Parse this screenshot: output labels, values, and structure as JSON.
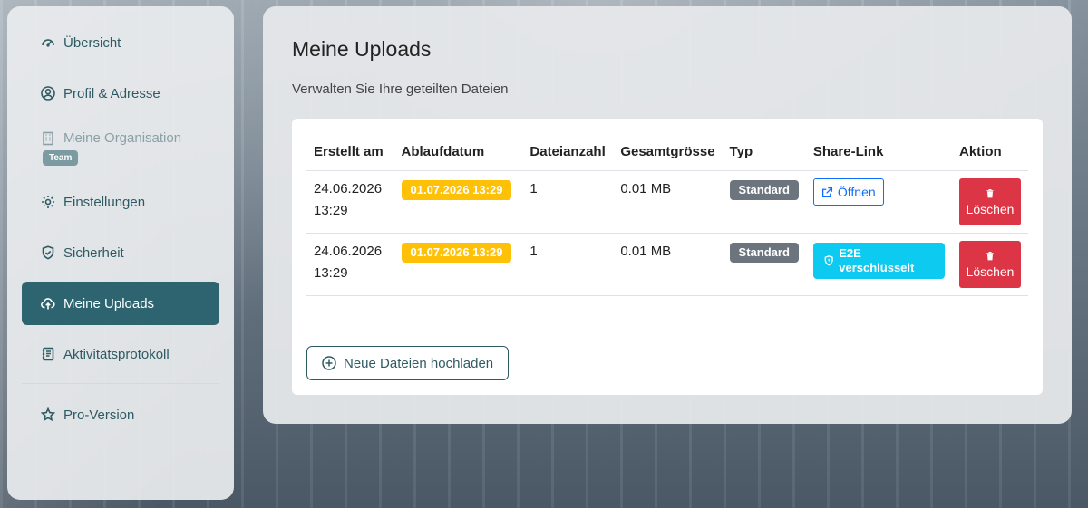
{
  "sidebar": {
    "items": [
      {
        "label": "Übersicht",
        "icon": "speedometer-icon"
      },
      {
        "label": "Profil & Adresse",
        "icon": "person-circle-icon"
      },
      {
        "label": "Meine Organisation",
        "icon": "building-icon",
        "badge": "Team",
        "disabled": true
      },
      {
        "label": "Einstellungen",
        "icon": "gear-icon"
      },
      {
        "label": "Sicherheit",
        "icon": "shield-check-icon"
      },
      {
        "label": "Meine Uploads",
        "icon": "cloud-upload-icon",
        "active": true
      },
      {
        "label": "Aktivitätsprotokoll",
        "icon": "journal-text-icon"
      },
      {
        "label": "Pro-Version",
        "icon": "star-icon"
      }
    ]
  },
  "main": {
    "title": "Meine Uploads",
    "subtitle": "Verwalten Sie Ihre geteilten Dateien",
    "table": {
      "headers": [
        "Erstellt am",
        "Ablaufdatum",
        "Dateianzahl",
        "Gesamtgrösse",
        "Typ",
        "Share-Link",
        "Aktion"
      ],
      "rows": [
        {
          "created_date": "24.06.2026",
          "created_time": "13:29",
          "expiry": "01.07.2026 13:29",
          "file_count": "1",
          "size": "0.01 MB",
          "type": "Standard",
          "share_label": "Öffnen",
          "action_label": "Löschen"
        },
        {
          "created_date": "24.06.2026",
          "created_time": "13:29",
          "expiry": "01.07.2026 13:29",
          "file_count": "1",
          "size": "0.01 MB",
          "type": "Standard",
          "share_label": "E2E verschlüsselt",
          "action_label": "Löschen"
        }
      ]
    },
    "upload_button": "Neue Dateien hochladen"
  },
  "colors": {
    "accent": "#2e6470",
    "warning": "#ffc107",
    "danger": "#dc3545",
    "info": "#0dcaf0",
    "primary": "#0d6efd",
    "secondary": "#6c757d"
  }
}
